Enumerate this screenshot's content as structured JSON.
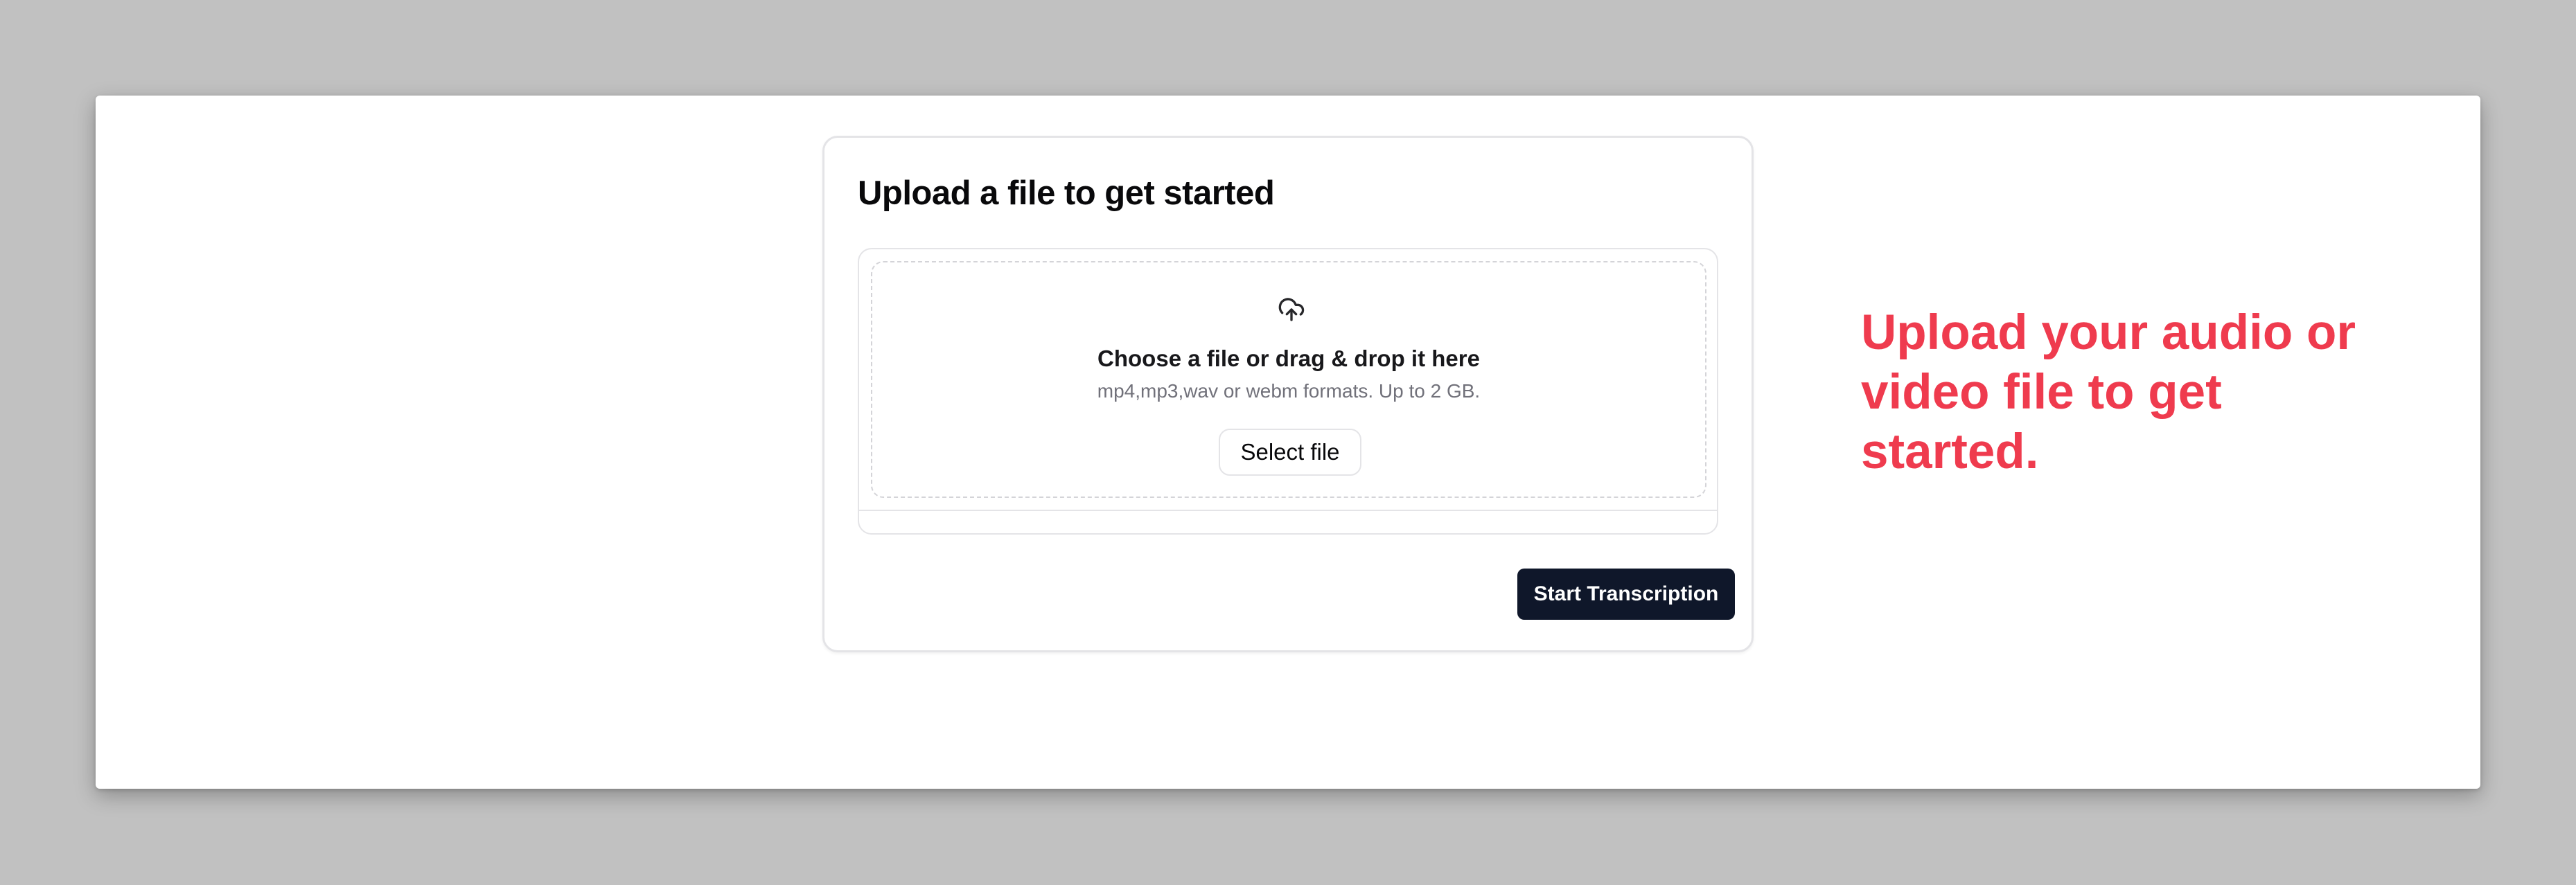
{
  "card": {
    "title": "Upload a file to get started"
  },
  "upload": {
    "icon": "cloud-upload-icon",
    "title": "Choose a file or drag & drop it here",
    "subtitle": "mp4,mp3,wav or webm formats. Up to 2 GB.",
    "select_label": "Select file"
  },
  "actions": {
    "start_label": "Start Transcription"
  },
  "promo": {
    "text": "Upload your audio or video file to get started."
  },
  "colors": {
    "primary_button": "#0f172a",
    "promo_text": "#ef3b4e",
    "backdrop": "#c1c1c1"
  }
}
